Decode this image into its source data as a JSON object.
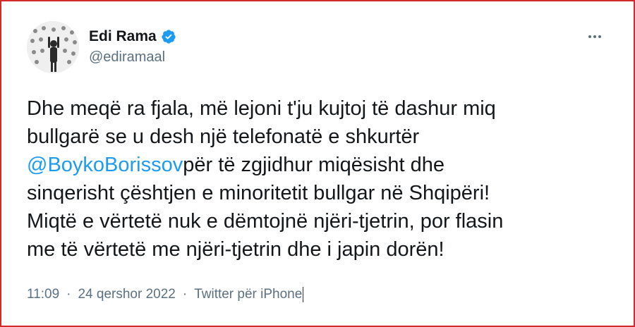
{
  "tweet": {
    "author": {
      "display_name": "Edi Rama",
      "handle": "@ediramaal",
      "verified": true,
      "avatar_icon": "profile-photo"
    },
    "more_icon": "more-options-icon",
    "text_before_mention": "Dhe meqë ra fjala, më lejoni t'ju kujtoj të dashur miq\nbullgarë se u desh një telefonatë e shkurtër\n",
    "mention": "@BoykoBorissov",
    "text_after_mention": "për të zgjidhur miqësisht dhe\nsinqerisht çështjen e minoritetit bullgar në Shqipëri!\nMiqtë e vërtetë nuk e dëmtojnë njëri-tjetrin, por flasin\nme të vërtetë me njëri-tjetrin dhe i japin dorën!",
    "time": "11:09",
    "separator": "·",
    "date": "24 qershor 2022",
    "separator2": "·",
    "source": "Twitter për iPhone"
  },
  "colors": {
    "frame_border": "#d42a2a",
    "mention": "#1d9bf0",
    "verified": "#1d9bf0",
    "text": "#14171a",
    "muted": "#5b7083"
  }
}
